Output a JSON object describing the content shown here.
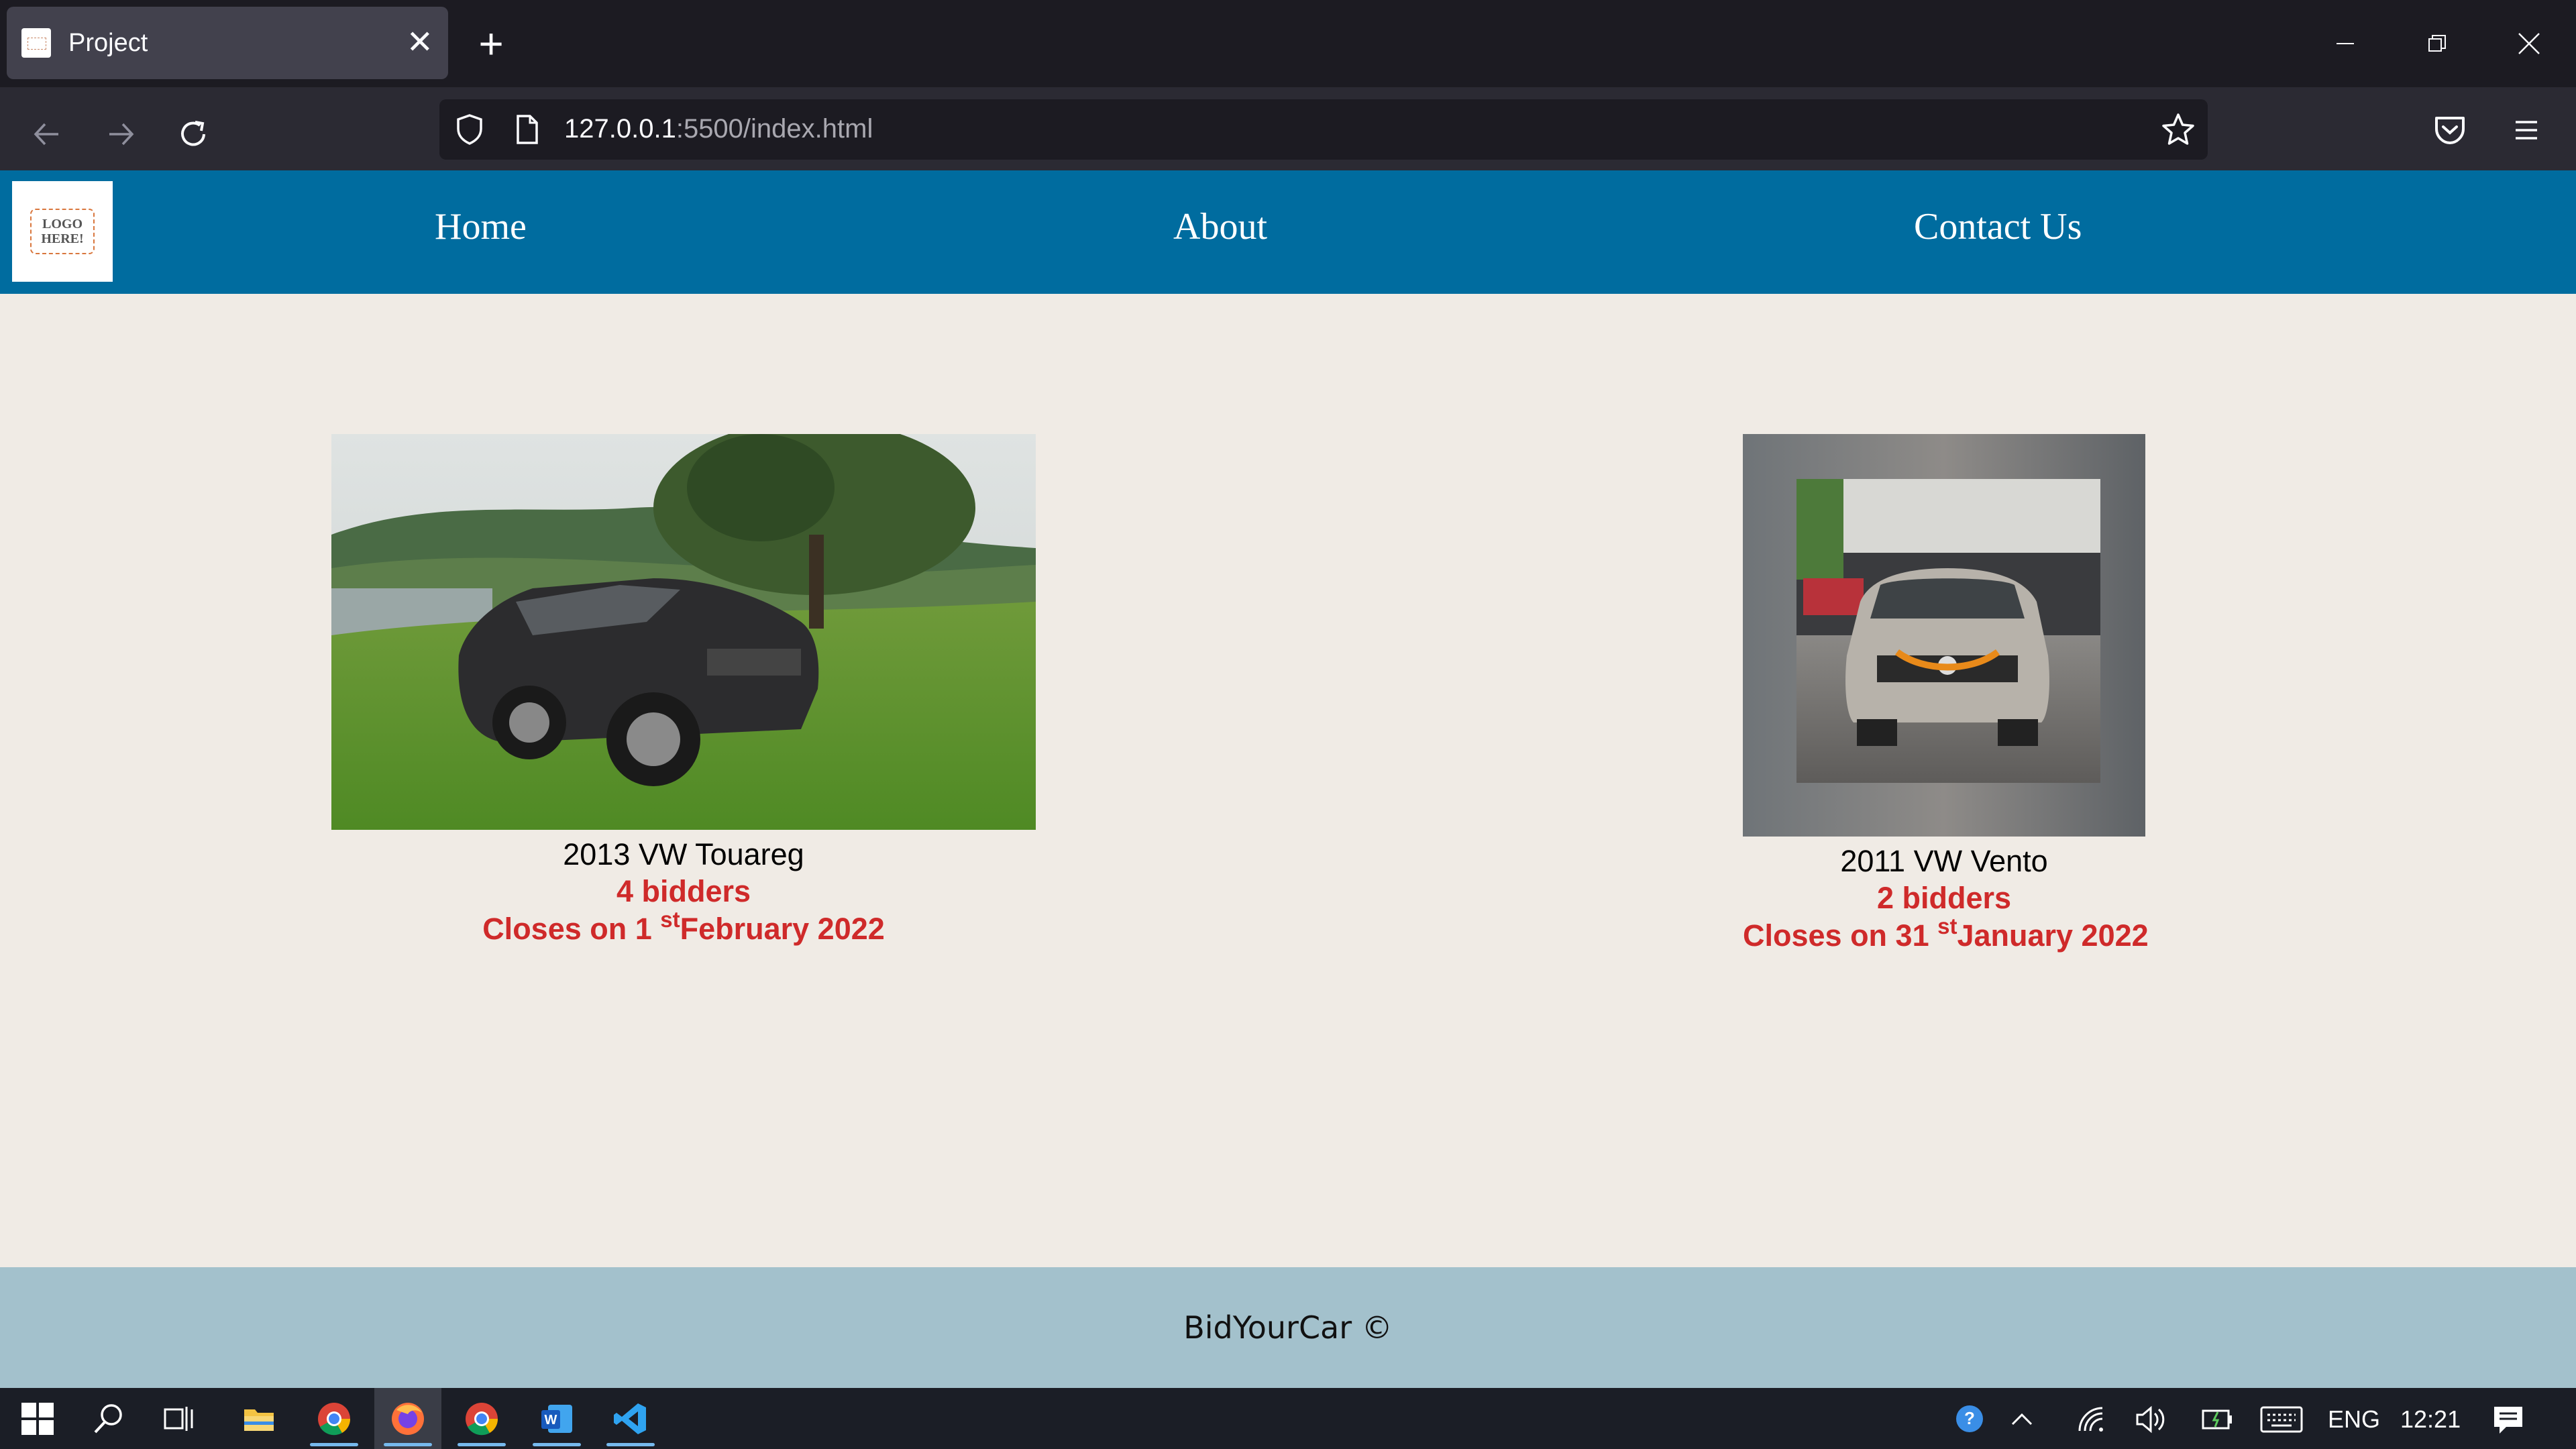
{
  "browser": {
    "tab_title": "Project",
    "url_host": "127.0.0.1",
    "url_rest": ":5500/index.html"
  },
  "site": {
    "logo_text": "LOGO HERE!",
    "nav": [
      {
        "label": "Home"
      },
      {
        "label": "About"
      },
      {
        "label": "Contact Us"
      }
    ],
    "listings": [
      {
        "title": "2013 VW Touareg",
        "bidders": "4 bidders",
        "closes_prefix": "Closes on 1 ",
        "closes_sup": "st",
        "closes_suffix": "February 2022"
      },
      {
        "title": "2011 VW Vento",
        "bidders": "2 bidders",
        "closes_prefix": "Closes on 31 ",
        "closes_sup": "st",
        "closes_suffix": "January 2022"
      }
    ],
    "footer": "BidYourCar ©"
  },
  "taskbar": {
    "apps": [
      "start-icon",
      "search-icon",
      "task-view-icon",
      "file-explorer-icon",
      "chrome-icon",
      "firefox-icon",
      "chrome-icon",
      "word-icon",
      "vscode-icon"
    ],
    "language": "ENG",
    "time": "12:21"
  },
  "colors": {
    "header": "#006c9f",
    "page_bg": "#f0ebe5",
    "footer": "#a3c1cc",
    "accent_red": "#cf2a2a"
  }
}
